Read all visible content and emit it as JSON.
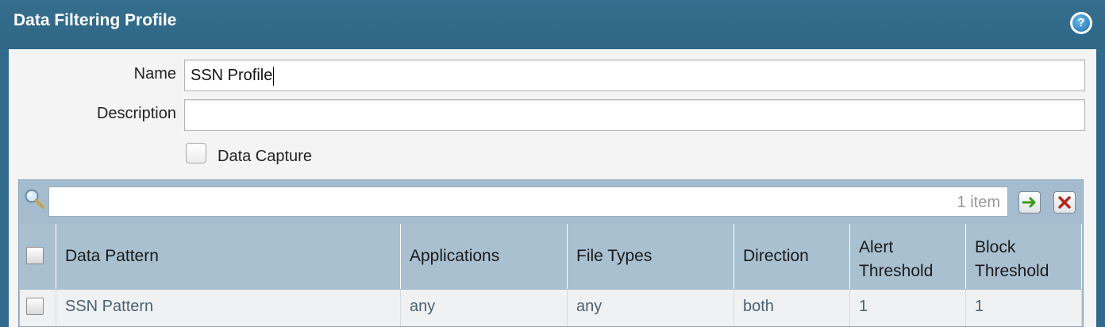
{
  "window": {
    "title": "Data Filtering Profile",
    "help_icon": "question-mark-circle-icon"
  },
  "form": {
    "name_label": "Name",
    "name_value": "SSN Profile",
    "description_label": "Description",
    "description_value": "",
    "data_capture_label": "Data Capture",
    "data_capture_checked": false
  },
  "grid": {
    "search_value": "",
    "item_count": "1 item",
    "icons": {
      "search": "magnifier-icon",
      "apply": "green-arrow-icon",
      "clear": "red-x-icon"
    },
    "columns": [
      {
        "key": "data_pattern",
        "label": "Data Pattern"
      },
      {
        "key": "applications",
        "label": "Applications"
      },
      {
        "key": "file_types",
        "label": "File Types"
      },
      {
        "key": "direction",
        "label": "Direction"
      },
      {
        "key": "alert_threshold",
        "label": "Alert Threshold"
      },
      {
        "key": "block_threshold",
        "label": "Block Threshold"
      }
    ],
    "rows": [
      {
        "data_pattern": "SSN Pattern",
        "applications": "any",
        "file_types": "any",
        "direction": "both",
        "alert_threshold": "1",
        "block_threshold": "1",
        "checked": false
      }
    ]
  },
  "colors": {
    "titlebar": "#316a8a",
    "grid_header": "#a9c0d1",
    "row_text": "#4a6170"
  }
}
